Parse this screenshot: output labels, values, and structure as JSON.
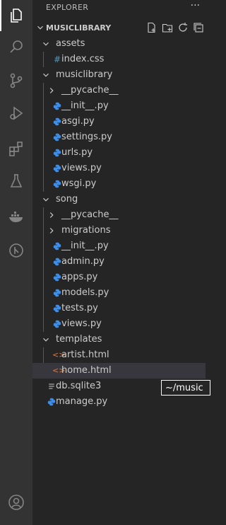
{
  "activity_bar": {
    "items": [
      {
        "name": "explorer-icon",
        "active": true
      },
      {
        "name": "search-icon"
      },
      {
        "name": "source-control-icon"
      },
      {
        "name": "run-debug-icon"
      },
      {
        "name": "extensions-icon"
      },
      {
        "name": "testing-icon"
      },
      {
        "name": "docker-icon"
      },
      {
        "name": "git-graph-icon"
      }
    ],
    "bottom": {
      "name": "account-icon"
    }
  },
  "explorer": {
    "title": "EXPLORER",
    "more": "···",
    "section_title": "MUSICLIBRARY",
    "actions": [
      "new-file-icon",
      "new-folder-icon",
      "refresh-icon",
      "collapse-all-icon"
    ]
  },
  "tree": [
    {
      "label": "assets",
      "type": "folder",
      "open": true,
      "depth": 0
    },
    {
      "label": "index.css",
      "type": "css",
      "depth": 1
    },
    {
      "label": "musiclibrary",
      "type": "folder",
      "open": true,
      "depth": 0
    },
    {
      "label": "__pycache__",
      "type": "folder",
      "open": false,
      "depth": 1
    },
    {
      "label": "__init__.py",
      "type": "py",
      "depth": 1
    },
    {
      "label": "asgi.py",
      "type": "py",
      "depth": 1
    },
    {
      "label": "settings.py",
      "type": "py",
      "depth": 1
    },
    {
      "label": "urls.py",
      "type": "py",
      "depth": 1
    },
    {
      "label": "views.py",
      "type": "py",
      "depth": 1
    },
    {
      "label": "wsgi.py",
      "type": "py",
      "depth": 1
    },
    {
      "label": "song",
      "type": "folder",
      "open": true,
      "depth": 0
    },
    {
      "label": "__pycache__",
      "type": "folder",
      "open": false,
      "depth": 1
    },
    {
      "label": "migrations",
      "type": "folder",
      "open": false,
      "depth": 1
    },
    {
      "label": "__init__.py",
      "type": "py",
      "depth": 1
    },
    {
      "label": "admin.py",
      "type": "py",
      "depth": 1
    },
    {
      "label": "apps.py",
      "type": "py",
      "depth": 1
    },
    {
      "label": "models.py",
      "type": "py",
      "depth": 1
    },
    {
      "label": "tests.py",
      "type": "py",
      "depth": 1
    },
    {
      "label": "views.py",
      "type": "py",
      "depth": 1
    },
    {
      "label": "templates",
      "type": "folder",
      "open": true,
      "depth": 0
    },
    {
      "label": "artist.html",
      "type": "html",
      "depth": 1
    },
    {
      "label": "home.html",
      "type": "html",
      "depth": 1,
      "selected": true
    },
    {
      "label": "db.sqlite3",
      "type": "db",
      "depth": 0
    },
    {
      "label": "manage.py",
      "type": "py",
      "depth": 0
    }
  ],
  "tooltip": {
    "text": "~/music"
  },
  "colors": {
    "python": "#3b8eea",
    "css": "#519aba",
    "html": "#e37933",
    "db": "#cccccc"
  }
}
